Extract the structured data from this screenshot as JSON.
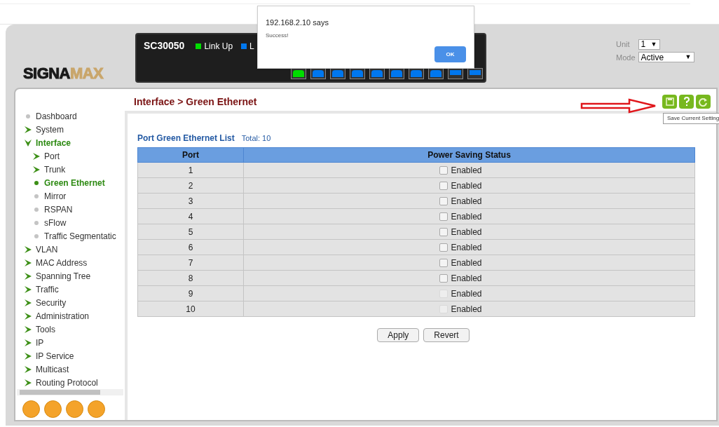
{
  "dialog": {
    "title": "192.168.2.10 says",
    "message": "Success!",
    "button": "OK"
  },
  "logo": {
    "dark": "SIGNA",
    "light": "MAX"
  },
  "switch_panel": {
    "model": "SC30050",
    "legend": [
      {
        "label": "Link Up",
        "color": "#00dd00"
      },
      {
        "label": "L",
        "color": "#0077ee"
      }
    ],
    "ports": [
      {
        "kind": "rj45",
        "color": "#00dd00"
      },
      {
        "kind": "rj45",
        "color": "#0077ee"
      },
      {
        "kind": "rj45",
        "color": "#0077ee"
      },
      {
        "kind": "rj45",
        "color": "#0077ee"
      },
      {
        "kind": "rj45",
        "color": "#0077ee"
      },
      {
        "kind": "rj45",
        "color": "#0077ee"
      },
      {
        "kind": "rj45",
        "color": "#0077ee"
      },
      {
        "kind": "rj45",
        "color": "#0077ee"
      },
      {
        "kind": "sfp",
        "color": "#0077ee"
      },
      {
        "kind": "sfp",
        "color": "#0077ee"
      }
    ]
  },
  "unit": {
    "label": "Unit",
    "value": "1",
    "arrow": "▼"
  },
  "mode": {
    "label": "Mode",
    "value": "Active",
    "arrow": "▼"
  },
  "sidebar": {
    "items": [
      {
        "label": "Dashboard",
        "kind": "leaf",
        "selected": false
      },
      {
        "label": "System",
        "kind": "folder",
        "expanded": false,
        "selected": false
      },
      {
        "label": "Interface",
        "kind": "folder",
        "expanded": true,
        "selected": true,
        "children": [
          {
            "label": "Port",
            "kind": "folder",
            "expanded": false,
            "selected": false
          },
          {
            "label": "Trunk",
            "kind": "folder",
            "expanded": false,
            "selected": false
          },
          {
            "label": "Green Ethernet",
            "kind": "leaf",
            "selected": true
          },
          {
            "label": "Mirror",
            "kind": "leaf",
            "selected": false
          },
          {
            "label": "RSPAN",
            "kind": "leaf",
            "selected": false
          },
          {
            "label": "sFlow",
            "kind": "leaf",
            "selected": false
          },
          {
            "label": "Traffic Segmentatic",
            "kind": "leaf",
            "selected": false
          }
        ]
      },
      {
        "label": "VLAN",
        "kind": "folder",
        "expanded": false,
        "selected": false
      },
      {
        "label": "MAC Address",
        "kind": "folder",
        "expanded": false,
        "selected": false
      },
      {
        "label": "Spanning Tree",
        "kind": "folder",
        "expanded": false,
        "selected": false
      },
      {
        "label": "Traffic",
        "kind": "folder",
        "expanded": false,
        "selected": false
      },
      {
        "label": "Security",
        "kind": "folder",
        "expanded": false,
        "selected": false
      },
      {
        "label": "Administration",
        "kind": "folder",
        "expanded": false,
        "selected": false
      },
      {
        "label": "Tools",
        "kind": "folder",
        "expanded": false,
        "selected": false
      },
      {
        "label": "IP",
        "kind": "folder",
        "expanded": false,
        "selected": false
      },
      {
        "label": "IP Service",
        "kind": "folder",
        "expanded": false,
        "selected": false
      },
      {
        "label": "Multicast",
        "kind": "folder",
        "expanded": false,
        "selected": false
      },
      {
        "label": "Routing Protocol",
        "kind": "folder",
        "expanded": false,
        "selected": false
      }
    ]
  },
  "breadcrumb": "Interface > Green Ethernet",
  "tooltip": "Save Current Setting",
  "list": {
    "title": "Port Green Ethernet List",
    "total": "Total: 10"
  },
  "table": {
    "columns": [
      "Port",
      "Power Saving Status"
    ],
    "rows": [
      {
        "port": "1",
        "status": "Enabled",
        "checked": false,
        "disabled": false
      },
      {
        "port": "2",
        "status": "Enabled",
        "checked": false,
        "disabled": false
      },
      {
        "port": "3",
        "status": "Enabled",
        "checked": false,
        "disabled": false
      },
      {
        "port": "4",
        "status": "Enabled",
        "checked": false,
        "disabled": false
      },
      {
        "port": "5",
        "status": "Enabled",
        "checked": false,
        "disabled": false
      },
      {
        "port": "6",
        "status": "Enabled",
        "checked": false,
        "disabled": false
      },
      {
        "port": "7",
        "status": "Enabled",
        "checked": false,
        "disabled": false
      },
      {
        "port": "8",
        "status": "Enabled",
        "checked": false,
        "disabled": false
      },
      {
        "port": "9",
        "status": "Enabled",
        "checked": false,
        "disabled": true
      },
      {
        "port": "10",
        "status": "Enabled",
        "checked": false,
        "disabled": true
      }
    ]
  },
  "buttons": [
    "Apply",
    "Revert"
  ]
}
